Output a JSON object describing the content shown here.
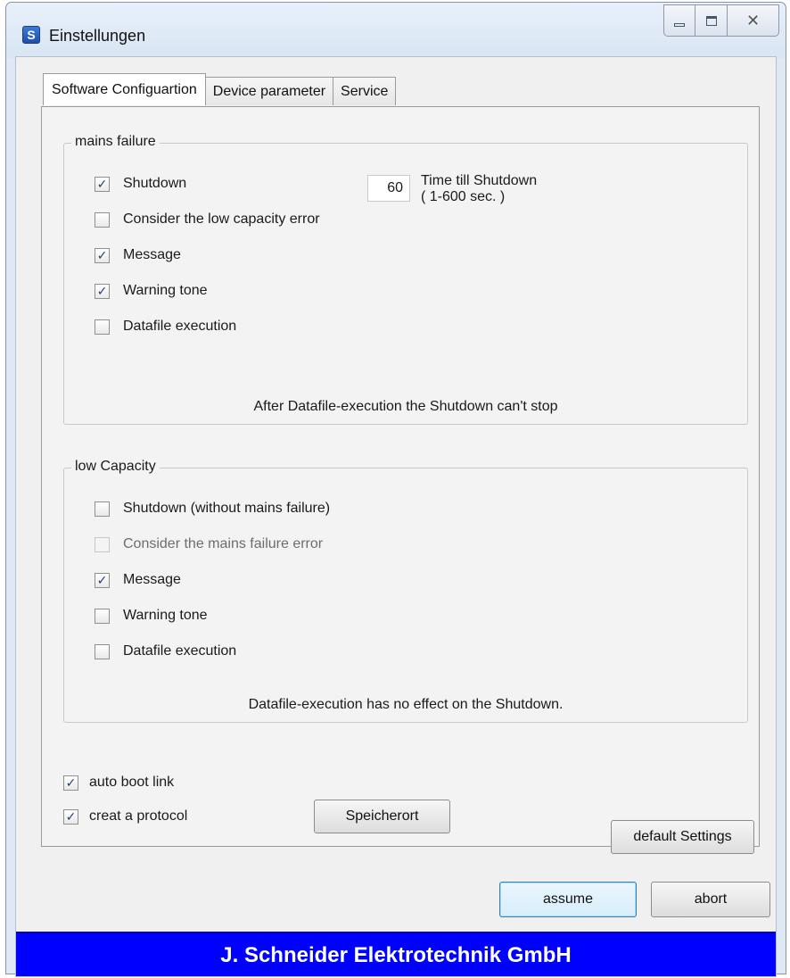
{
  "window": {
    "title": "Einstellungen",
    "icon": "app-s-icon"
  },
  "caption": {
    "minimize": "minimize-icon",
    "maximize": "maximize-icon",
    "close": "✕"
  },
  "tabs": [
    {
      "label": "Software Configuartion",
      "active": true
    },
    {
      "label": "Device parameter",
      "active": false
    },
    {
      "label": "Service",
      "active": false
    }
  ],
  "mains_failure": {
    "title": "mains failure",
    "shutdown": {
      "label": "Shutdown",
      "checked": true
    },
    "low_capacity_error": {
      "label": "Consider the low capacity error",
      "checked": false
    },
    "message": {
      "label": "Message",
      "checked": true
    },
    "warning_tone": {
      "label": "Warning tone",
      "checked": true
    },
    "datafile": {
      "label": "Datafile execution",
      "checked": false
    },
    "time_value": "60",
    "time_label_1": "Time till Shutdown",
    "time_label_2": "( 1-600 sec. )",
    "note": "After Datafile-execution the Shutdown can't stop"
  },
  "low_capacity": {
    "title": "low Capacity",
    "shutdown": {
      "label": "Shutdown (without mains failure)",
      "checked": false
    },
    "mains_error": {
      "label": "Consider the mains failure error",
      "checked": false,
      "disabled": true
    },
    "message": {
      "label": "Message",
      "checked": true
    },
    "warning_tone": {
      "label": "Warning tone",
      "checked": false
    },
    "datafile": {
      "label": "Datafile execution",
      "checked": false
    },
    "note": "Datafile-execution has no effect on the Shutdown."
  },
  "options": {
    "auto_boot": {
      "label": "auto boot link",
      "checked": true
    },
    "protocol": {
      "label": "creat a protocol",
      "checked": true
    },
    "speicherort": "Speicherort",
    "default_settings": "default Settings"
  },
  "actions": {
    "assume": "assume",
    "abort": "abort"
  },
  "footer": "J. Schneider Elektrotechnik GmbH",
  "check_glyph": "✓"
}
